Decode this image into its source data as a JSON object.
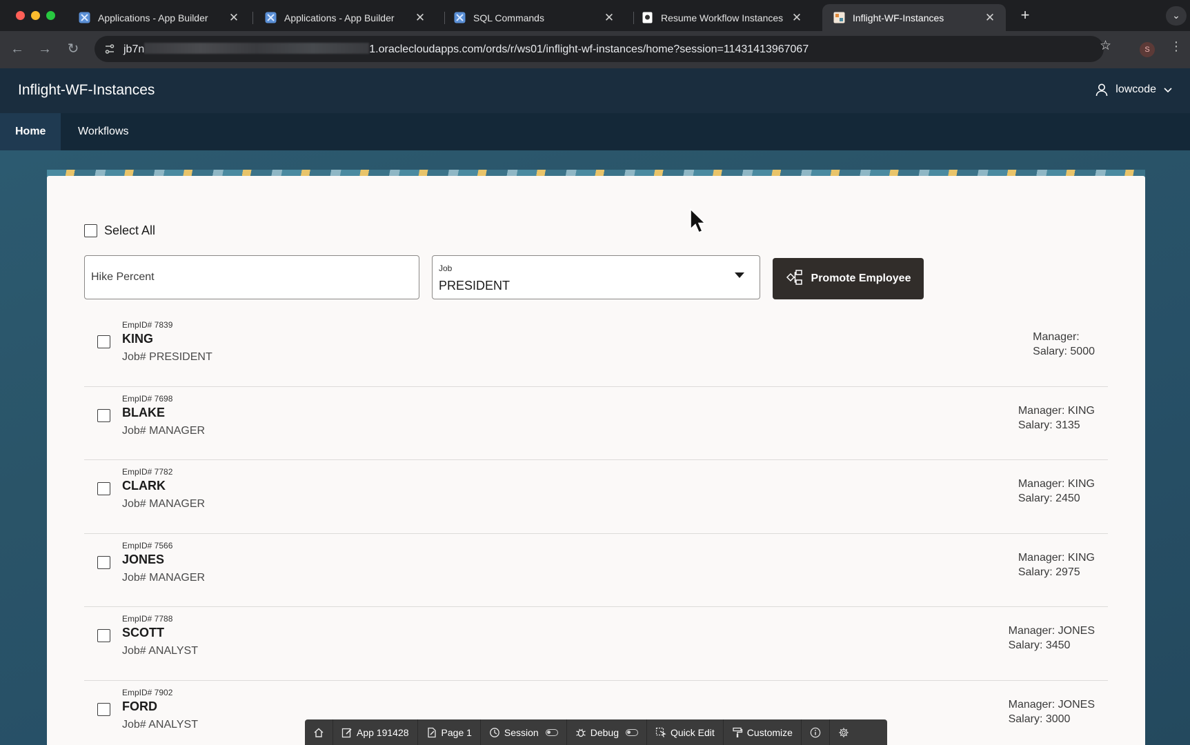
{
  "browser": {
    "tabs": [
      {
        "title": "Applications - App Builder",
        "active": false,
        "icon": "apex-builder-icon"
      },
      {
        "title": "Applications - App Builder",
        "active": false,
        "icon": "apex-builder-icon"
      },
      {
        "title": "SQL Commands",
        "active": false,
        "icon": "apex-builder-icon"
      },
      {
        "title": "Resume Workflow Instances",
        "active": false,
        "icon": "document-icon"
      },
      {
        "title": "Inflight-WF-Instances",
        "active": true,
        "icon": "app-icon"
      }
    ],
    "url_prefix": "jb7n",
    "url_suffix": "1.oraclecloudapps.com/ords/r/ws01/inflight-wf-instances/home?session=11431413967067",
    "profile_initial": "S"
  },
  "app": {
    "title": "Inflight-WF-Instances",
    "user": "lowcode"
  },
  "nav": {
    "tabs": [
      {
        "label": "Home",
        "active": true
      },
      {
        "label": "Workflows",
        "active": false
      }
    ]
  },
  "form": {
    "select_all_label": "Select All",
    "hike_placeholder": "Hike Percent",
    "job_label": "Job",
    "job_value": "PRESIDENT",
    "promote_label": "Promote Employee"
  },
  "employees": [
    {
      "empid": "EmpID# 7839",
      "name": "KING",
      "job": "Job# PRESIDENT",
      "manager": "Manager:",
      "salary": "Salary: 5000"
    },
    {
      "empid": "EmpID# 7698",
      "name": "BLAKE",
      "job": "Job# MANAGER",
      "manager": "Manager: KING",
      "salary": "Salary: 3135"
    },
    {
      "empid": "EmpID# 7782",
      "name": "CLARK",
      "job": "Job# MANAGER",
      "manager": "Manager: KING",
      "salary": "Salary: 2450"
    },
    {
      "empid": "EmpID# 7566",
      "name": "JONES",
      "job": "Job# MANAGER",
      "manager": "Manager: KING",
      "salary": "Salary: 2975"
    },
    {
      "empid": "EmpID# 7788",
      "name": "SCOTT",
      "job": "Job# ANALYST",
      "manager": "Manager: JONES",
      "salary": "Salary: 3450"
    },
    {
      "empid": "EmpID# 7902",
      "name": "FORD",
      "job": "Job# ANALYST",
      "manager": "Manager: JONES",
      "salary": "Salary: 3000"
    }
  ],
  "devtoolbar": {
    "app": "App 191428",
    "page": "Page 1",
    "session": "Session",
    "debug": "Debug",
    "quick_edit": "Quick Edit",
    "customize": "Customize"
  },
  "colors": {
    "header": "#1a2d3e",
    "nav": "#142838",
    "button": "#312d2a",
    "card": "#fbf9f8"
  }
}
